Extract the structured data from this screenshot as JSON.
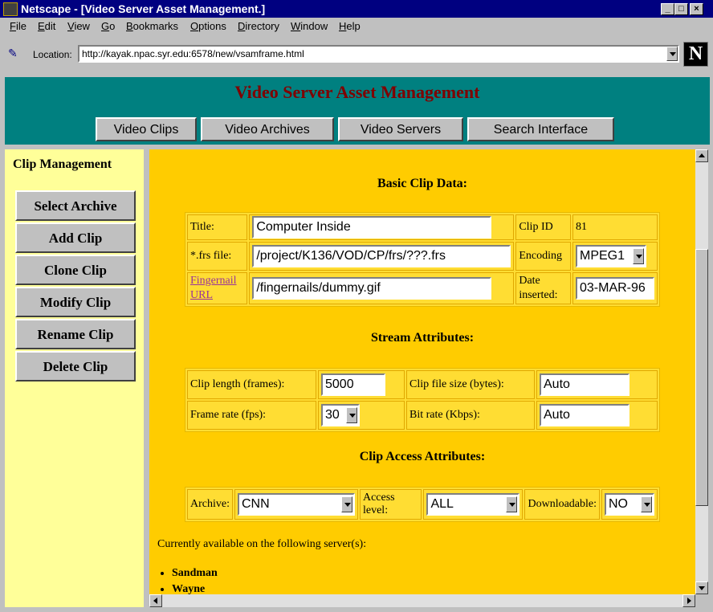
{
  "window": {
    "title": "Netscape - [Video Server Asset Management.]",
    "controls": [
      "_",
      "□",
      "×"
    ]
  },
  "menu": [
    "File",
    "Edit",
    "View",
    "Go",
    "Bookmarks",
    "Options",
    "Directory",
    "Window",
    "Help"
  ],
  "location": {
    "label": "Location:",
    "url": "http://kayak.npac.syr.edu:6578/new/vsamframe.html",
    "logo": "N"
  },
  "header": {
    "title": "Video Server Asset Management",
    "nav": [
      "Video Clips",
      "Video Archives",
      "Video Servers",
      "Search Interface"
    ]
  },
  "sidebar": {
    "title": "Clip Management",
    "buttons": [
      "Select Archive",
      "Add Clip",
      "Clone Clip",
      "Modify Clip",
      "Rename Clip",
      "Delete Clip"
    ]
  },
  "basic": {
    "heading": "Basic Clip Data:",
    "title_label": "Title:",
    "title_value": "Computer Inside",
    "clip_id_label": "Clip ID",
    "clip_id_value": "81",
    "frs_label": "*.frs file:",
    "frs_value": "/project/K136/VOD/CP/frs/???.frs",
    "encoding_label": "Encoding",
    "encoding_value": "MPEG1",
    "fingernail_label_1": "Fingernail",
    "fingernail_label_2": "URL",
    "fingernail_value": "/fingernails/dummy.gif",
    "date_label_1": "Date",
    "date_label_2": "inserted:",
    "date_value": "03-MAR-96"
  },
  "stream": {
    "heading": "Stream Attributes:",
    "length_label": "Clip length (frames):",
    "length_value": "5000",
    "size_label": "Clip file size (bytes):",
    "size_value": "Auto",
    "rate_label": "Frame rate (fps):",
    "rate_value": "30",
    "bitrate_label": "Bit rate (Kbps):",
    "bitrate_value": "Auto"
  },
  "access": {
    "heading": "Clip Access Attributes:",
    "archive_label": "Archive:",
    "archive_value": "CNN",
    "level_label": "Access level:",
    "level_value": "ALL",
    "download_label": "Downloadable:",
    "download_value": "NO"
  },
  "servers": {
    "intro": "Currently available on the following server(s):",
    "list": [
      "Sandman",
      "Wayne"
    ]
  }
}
